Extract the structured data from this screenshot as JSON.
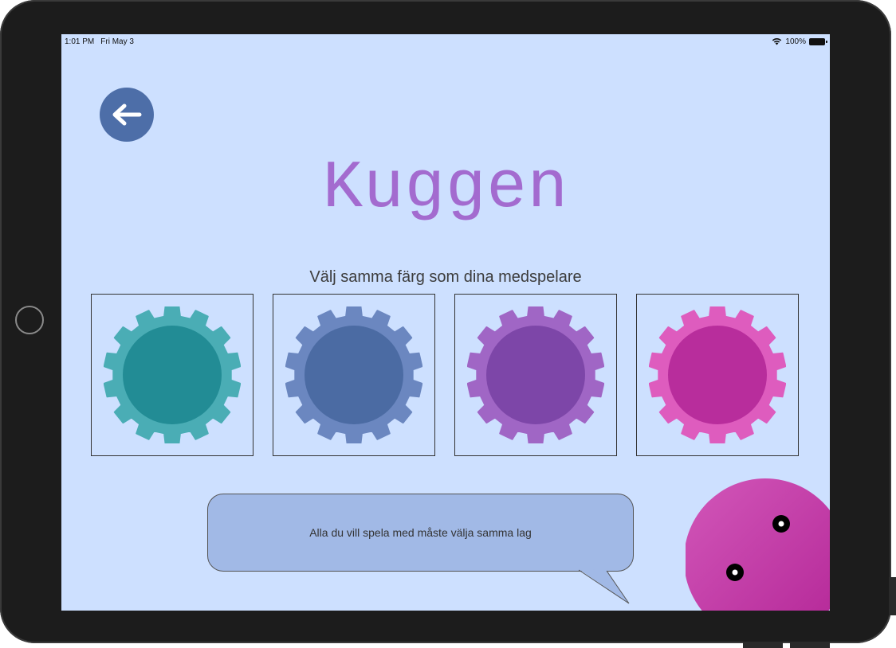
{
  "status_bar": {
    "time": "1:01 PM",
    "date": "Fri May 3",
    "battery": "100%"
  },
  "title": "Kuggen",
  "subtitle": "Välj samma färg som dina medspelare",
  "teams": [
    {
      "name": "teal",
      "outer": "#4aadb5",
      "inner": "#228c95"
    },
    {
      "name": "blue",
      "outer": "#6b87c0",
      "inner": "#4b6ba3"
    },
    {
      "name": "purple",
      "outer": "#a066c5",
      "inner": "#7d46a8"
    },
    {
      "name": "pink",
      "outer": "#de5cbe",
      "inner": "#b82d9c"
    }
  ],
  "speech_bubble": {
    "text": "Alla du vill spela med måste välja samma lag"
  },
  "icons": {
    "back": "arrow-left-icon",
    "wifi": "wifi-icon",
    "battery": "battery-icon"
  },
  "colors": {
    "background": "#cde0ff",
    "title": "#a36bcf",
    "back_button": "#4d6ea8",
    "bubble": "#a1b9e6"
  }
}
